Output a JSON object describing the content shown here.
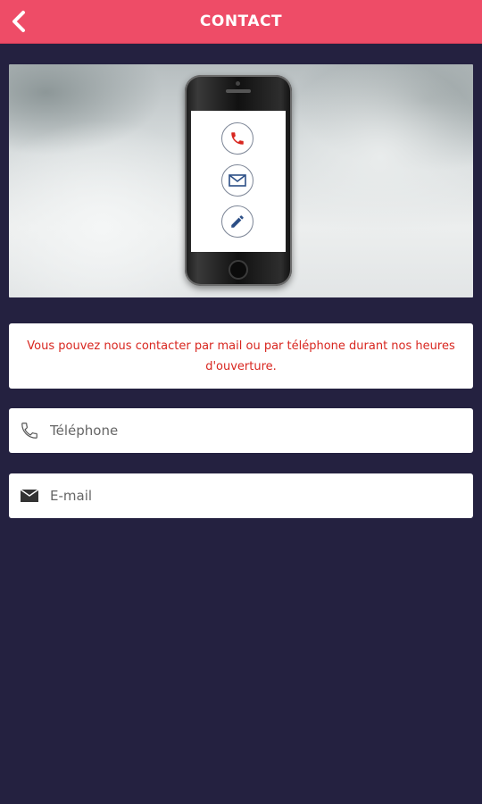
{
  "appbar": {
    "title": "CONTACT",
    "back_icon": "chevron-left-icon",
    "color": "#ee4c67"
  },
  "banner": {
    "icons": [
      "phone-icon",
      "mail-icon",
      "pencil-icon"
    ]
  },
  "info": {
    "text": "Vous pouvez nous contacter par mail ou par téléphone durant nos heures d'ouverture.",
    "text_color": "#d8261f"
  },
  "form": {
    "phone": {
      "placeholder": "Téléphone",
      "icon": "phone-icon",
      "value": ""
    },
    "email": {
      "placeholder": "E-mail",
      "icon": "envelope-icon",
      "value": ""
    }
  },
  "theme": {
    "background": "#242140"
  }
}
